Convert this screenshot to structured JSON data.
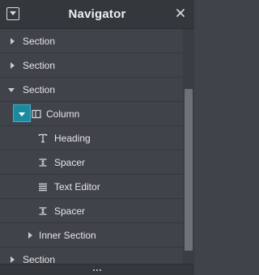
{
  "header": {
    "title": "Navigator",
    "collapse_icon": "collapse-panel-icon",
    "close_icon": "close-icon"
  },
  "tree": {
    "rows": [
      {
        "label": "Section",
        "state": "collapsed"
      },
      {
        "label": "Section",
        "state": "collapsed"
      },
      {
        "label": "Section",
        "state": "expanded"
      },
      {
        "label": "Column",
        "state": "expanded",
        "icon": "column-icon",
        "selected_caret": true
      },
      {
        "label": "Heading",
        "icon": "heading-icon"
      },
      {
        "label": "Spacer",
        "icon": "spacer-icon"
      },
      {
        "label": "Text Editor",
        "icon": "text-editor-icon"
      },
      {
        "label": "Spacer",
        "icon": "spacer-icon"
      },
      {
        "label": "Inner Section",
        "state": "collapsed"
      },
      {
        "label": "Section",
        "state": "collapsed"
      }
    ]
  },
  "colors": {
    "background": "#404349",
    "header": "#34383c",
    "accent": "#1b8aa0"
  },
  "footer": {
    "icon": "more-dots-icon"
  }
}
